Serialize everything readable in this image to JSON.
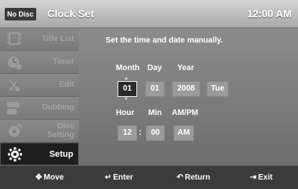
{
  "header": {
    "badge": "No Disc",
    "title": "Clock Set",
    "time": "12:00 AM"
  },
  "sidebar": {
    "items": [
      {
        "label": "Title List",
        "icon": "film-strip-icon",
        "active": false
      },
      {
        "label": "Timer",
        "icon": "timer-icon",
        "active": false
      },
      {
        "label": "Edit",
        "icon": "scissors-icon",
        "active": false
      },
      {
        "label": "Dubbing",
        "icon": "dubbing-icon",
        "active": false
      },
      {
        "label": "Disc\nSetting",
        "icon": "disc-icon",
        "active": false
      },
      {
        "label": "Setup",
        "icon": "gear-icon",
        "active": true
      }
    ]
  },
  "main": {
    "instruction": "Set the time and date manually.",
    "date_labels": {
      "month": "Month",
      "day": "Day",
      "year": "Year"
    },
    "date_values": {
      "month": "01",
      "day": "01",
      "year": "2008",
      "weekday": "Tue"
    },
    "time_labels": {
      "hour": "Hour",
      "min": "Min",
      "ampm": "AM/PM"
    },
    "time_values": {
      "hour": "12",
      "separator": ":",
      "min": "00",
      "ampm": "AM"
    }
  },
  "footer": {
    "move": "Move",
    "enter": "Enter",
    "return": "Return",
    "exit": "Exit"
  }
}
